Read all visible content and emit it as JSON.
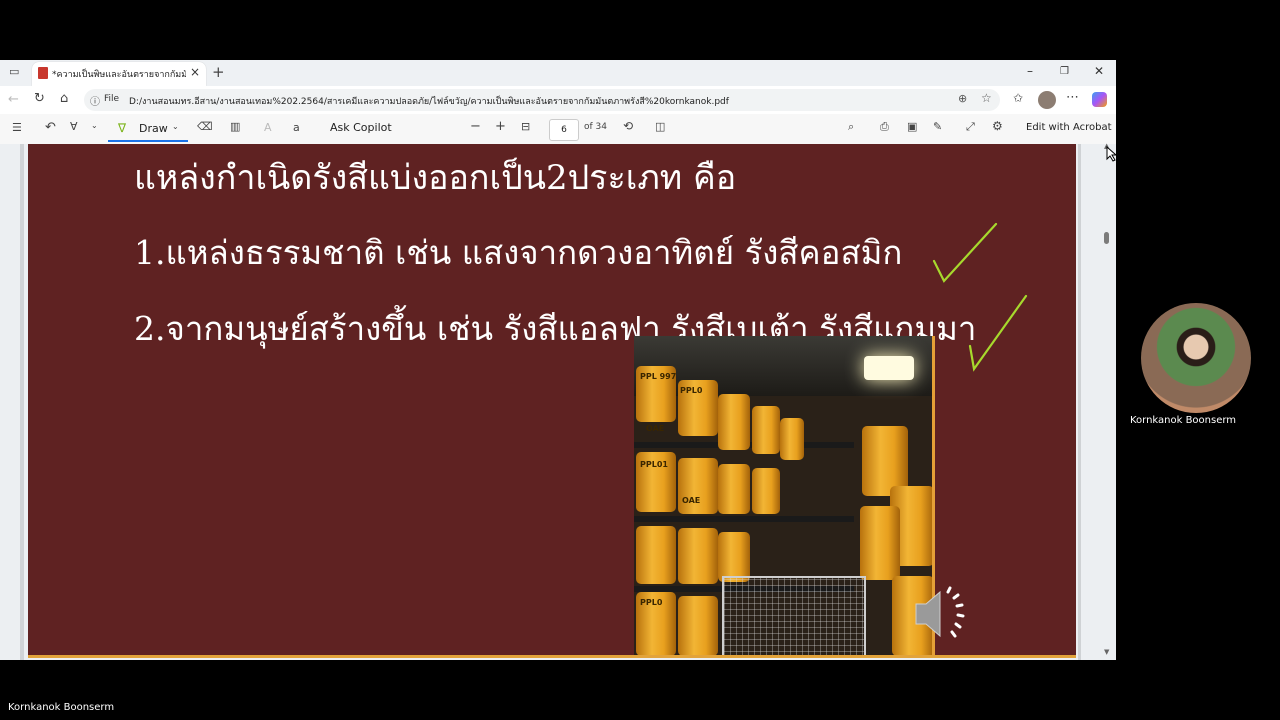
{
  "browser": {
    "tab_title": "*ความเป็นพิษและอันตรายจากกัมมันตภาพรังสี",
    "address_label": "File",
    "url": "D:/งานสอนมทร.อีสาน/งานสอนเทอม%202.2564/สารเคมีและความปลอดภัย/ไฟล์ขวัญ/ความเป็นพิษและอันตรายจากกัมมันตภาพรังสี%20kornkanok.pdf"
  },
  "pdf_toolbar": {
    "draw_label": "Draw",
    "ask_copilot_label": "Ask Copilot",
    "page_current": "6",
    "page_total": "of 34",
    "edit_acrobat_label": "Edit with Acrobat"
  },
  "slide": {
    "heading": "แหล่งกำเนิดรังสีแบ่งออกเป็น2ประเภท คือ",
    "item1": "1.แหล่งธรรมชาติ เช่น แสงจากดวงอาทิตย์ รังสีคอสมิก",
    "item2": "2.จากมนุษย์สร้างขึ้น เช่น รังสีแอลฟา รังสีเบเต้า รังสีแกมมา",
    "barrel_labels": [
      "PPL 997",
      "PPL0",
      "OAE",
      "PPL01",
      "OAE",
      "PPL0"
    ]
  },
  "participant": {
    "name": "Kornkanok Boonserm"
  },
  "footer": {
    "name": "Kornkanok Boonserm"
  },
  "colors": {
    "slide_background": "#5f2222",
    "checkmark": "#a7d92d",
    "accent": "#1a73e8"
  }
}
